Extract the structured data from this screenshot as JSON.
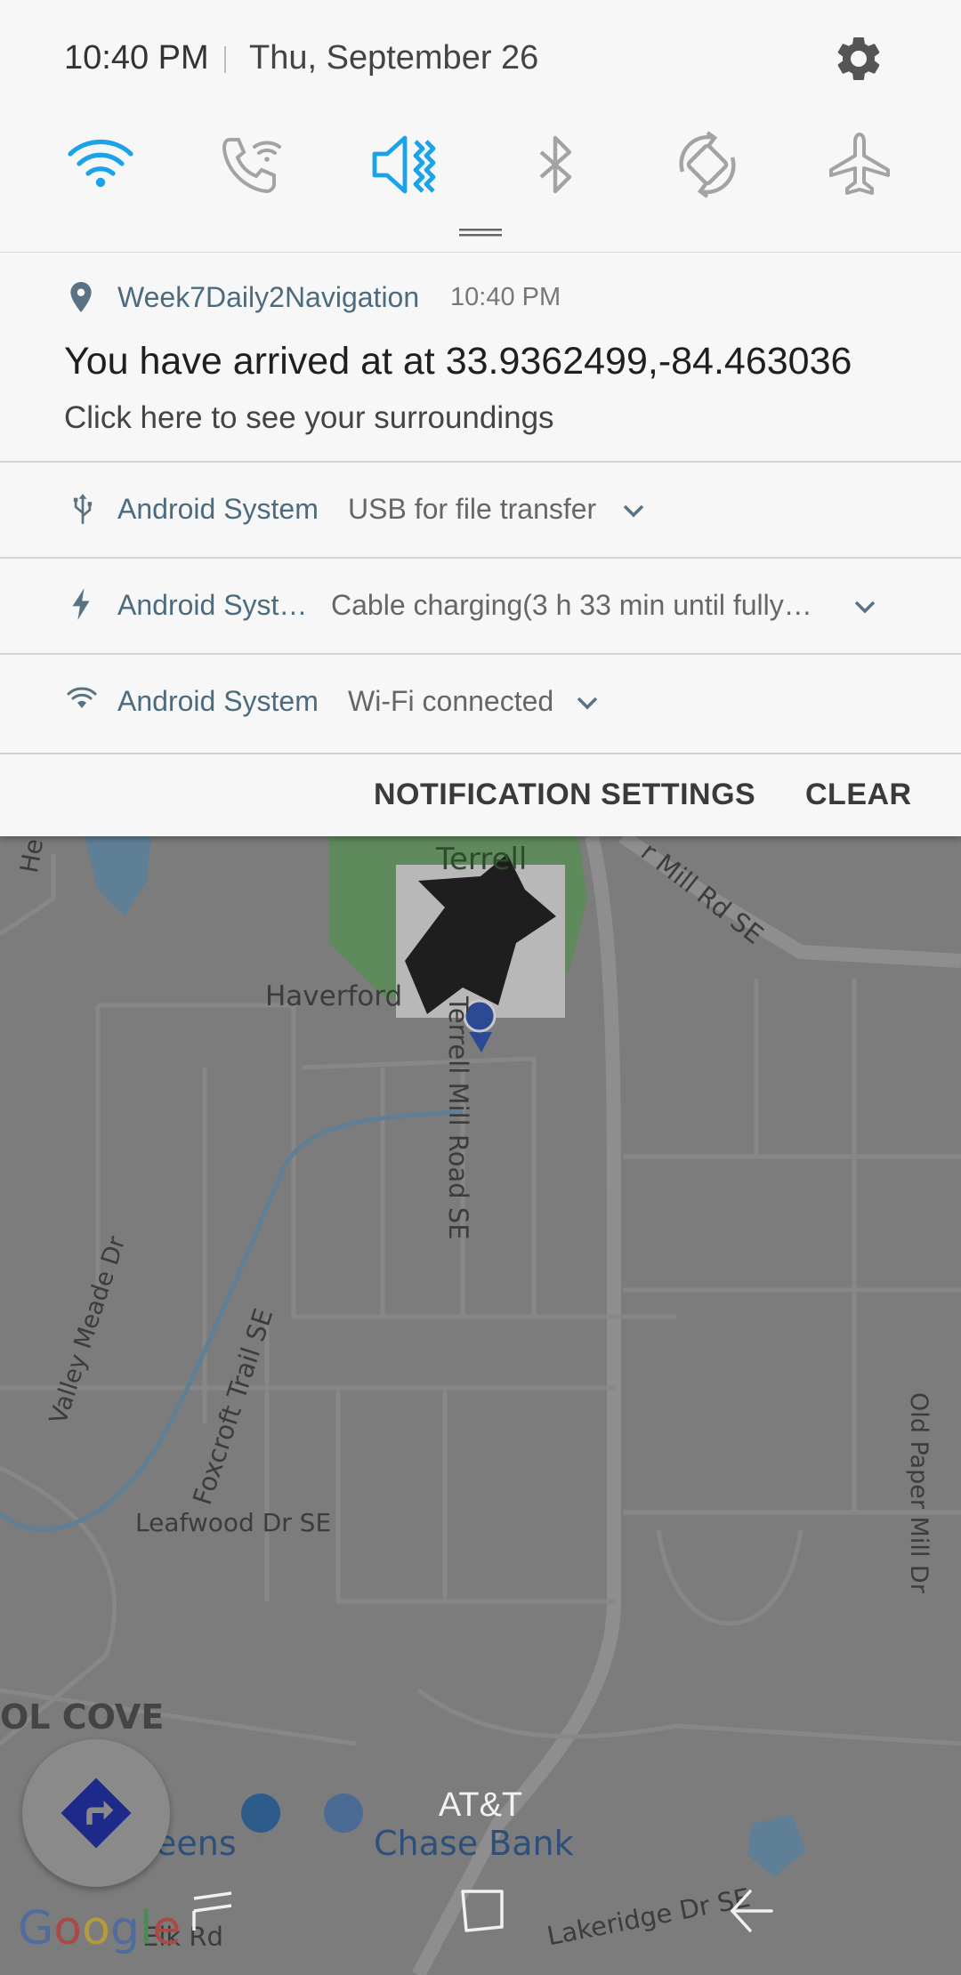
{
  "status": {
    "time": "10:40 PM",
    "date": "Thu, September 26"
  },
  "quick_settings": [
    {
      "name": "wifi-icon",
      "active": true
    },
    {
      "name": "wifi-calling-icon",
      "active": false
    },
    {
      "name": "mute-icon",
      "active": true
    },
    {
      "name": "bluetooth-icon",
      "active": false
    },
    {
      "name": "auto-rotate-icon",
      "active": false
    },
    {
      "name": "airplane-mode-icon",
      "active": false
    }
  ],
  "notifications": {
    "nav": {
      "app": "Week7Daily2Navigation",
      "time": "10:40 PM",
      "title": "You have arrived at at 33.9362499,-84.463036",
      "subtitle": "Click here to see your surroundings"
    },
    "usb": {
      "app": "Android System",
      "detail": "USB for file transfer"
    },
    "charging": {
      "app": "Android Syst…",
      "detail": "Cable charging(3 h 33 min until fully…"
    },
    "wifi": {
      "app": "Android System",
      "detail": "Wi-Fi connected"
    }
  },
  "actions": {
    "settings_label": "NOTIFICATION SETTINGS",
    "clear_label": "CLEAR"
  },
  "map": {
    "labels": {
      "terrell": "Terrell",
      "haverford": "Haverford",
      "terrell_mill_road": "Terrell Mill Road SE",
      "mill_rd": "r Mill Rd SE",
      "valley_meade": "Valley Meade Dr",
      "foxcroft": "Foxcroft Trail SE",
      "leafwood": "Leafwood Dr SE",
      "old_paper_mill": "Old Paper Mill Dr",
      "cove": "OL COVE",
      "greens": "eens",
      "chase": "Chase Bank",
      "lakeridge": "Lakeridge Dr SE",
      "elk": "Elk Rd",
      "he": "He"
    }
  },
  "carrier": "AT&T",
  "google_logo": "Google",
  "colors": {
    "accent": "#1aa3e8",
    "inactive_icon": "#a3a3a3",
    "app_name": "#4d6b7f"
  }
}
